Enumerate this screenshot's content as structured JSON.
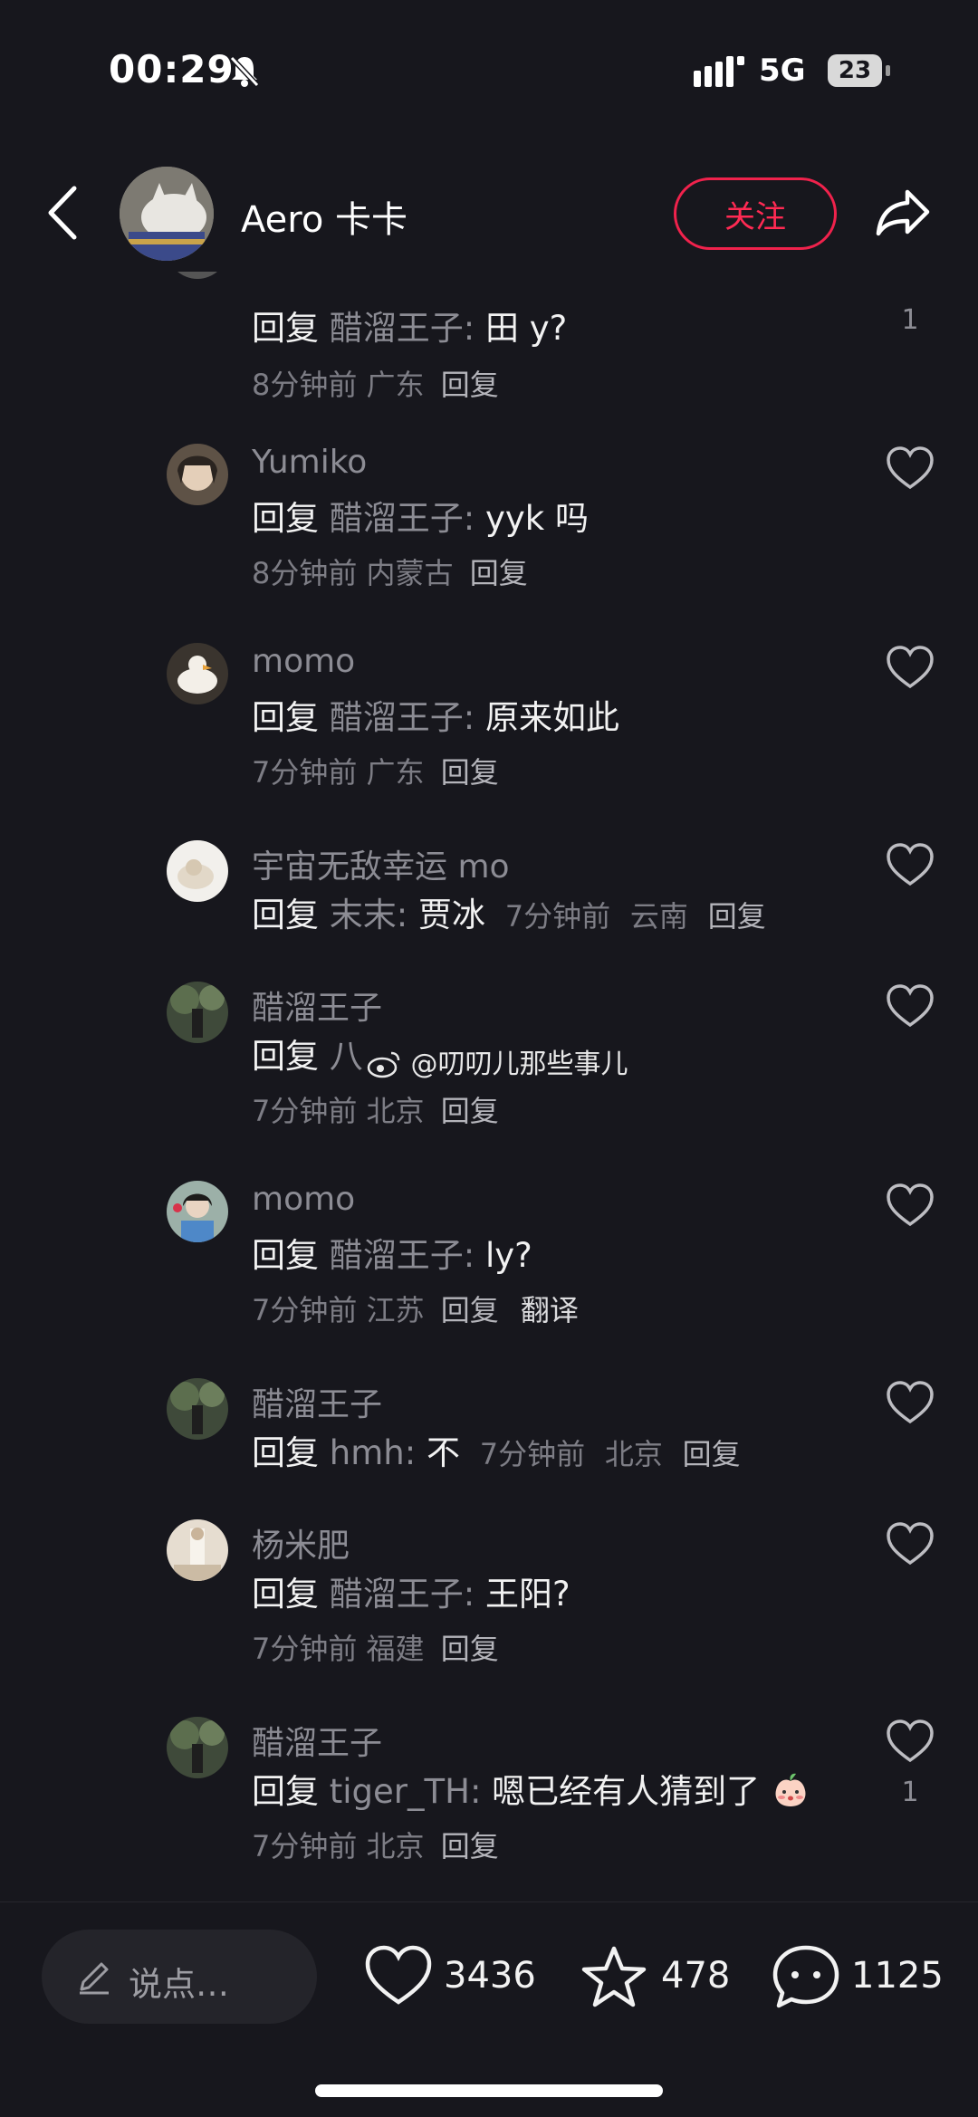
{
  "status_bar": {
    "time": "00:29",
    "network": "5G",
    "battery": "23"
  },
  "header": {
    "username": "Aero 卡卡",
    "follow_label": "关注"
  },
  "comments": [
    {
      "name": "",
      "reply_prefix": "回复",
      "reply_to": "醋溜王子:",
      "text": "田 y?",
      "time": "8分钟前",
      "location": "广东",
      "reply_label": "回复",
      "like_count": "1"
    },
    {
      "name": "Yumiko",
      "reply_prefix": "回复",
      "reply_to": "醋溜王子:",
      "text": "yyk 吗",
      "time": "8分钟前",
      "location": "内蒙古",
      "reply_label": "回复"
    },
    {
      "name": "momo",
      "reply_prefix": "回复",
      "reply_to": "醋溜王子:",
      "text": "原来如此",
      "time": "7分钟前",
      "location": "广东",
      "reply_label": "回复"
    },
    {
      "name": "宇宙无敌幸运 mo",
      "reply_prefix": "回复",
      "reply_to": "末末:",
      "text": "贾冰",
      "time": "7分钟前",
      "location": "云南",
      "reply_label": "回复"
    },
    {
      "name": "醋溜王子",
      "reply_prefix": "回复",
      "reply_to": "八",
      "text": "",
      "time": "7分钟前",
      "location": "北京",
      "reply_label": "回复"
    },
    {
      "name": "momo",
      "reply_prefix": "回复",
      "reply_to": "醋溜王子:",
      "text": "ly?",
      "time": "7分钟前",
      "location": "江苏",
      "reply_label": "回复",
      "translate_label": "翻译"
    },
    {
      "name": "醋溜王子",
      "reply_prefix": "回复",
      "reply_to": "hmh:",
      "text": "不",
      "time": "7分钟前",
      "location": "北京",
      "reply_label": "回复"
    },
    {
      "name": "杨米肥",
      "reply_prefix": "回复",
      "reply_to": "醋溜王子:",
      "text": "王阳?",
      "time": "7分钟前",
      "location": "福建",
      "reply_label": "回复"
    },
    {
      "name": "醋溜王子",
      "reply_prefix": "回复",
      "reply_to": "tiger_TH:",
      "text": "嗯已经有人猜到了",
      "time": "7分钟前",
      "location": "北京",
      "reply_label": "回复",
      "like_count": "1"
    }
  ],
  "watermark": "@叨叨儿那些事儿",
  "bottom_bar": {
    "input_placeholder": "说点…",
    "likes": "3436",
    "favorites": "478",
    "comments": "1125"
  },
  "colors": {
    "background": "#17171d",
    "accent": "#ff2a53",
    "muted_text": "#8c8c94"
  }
}
